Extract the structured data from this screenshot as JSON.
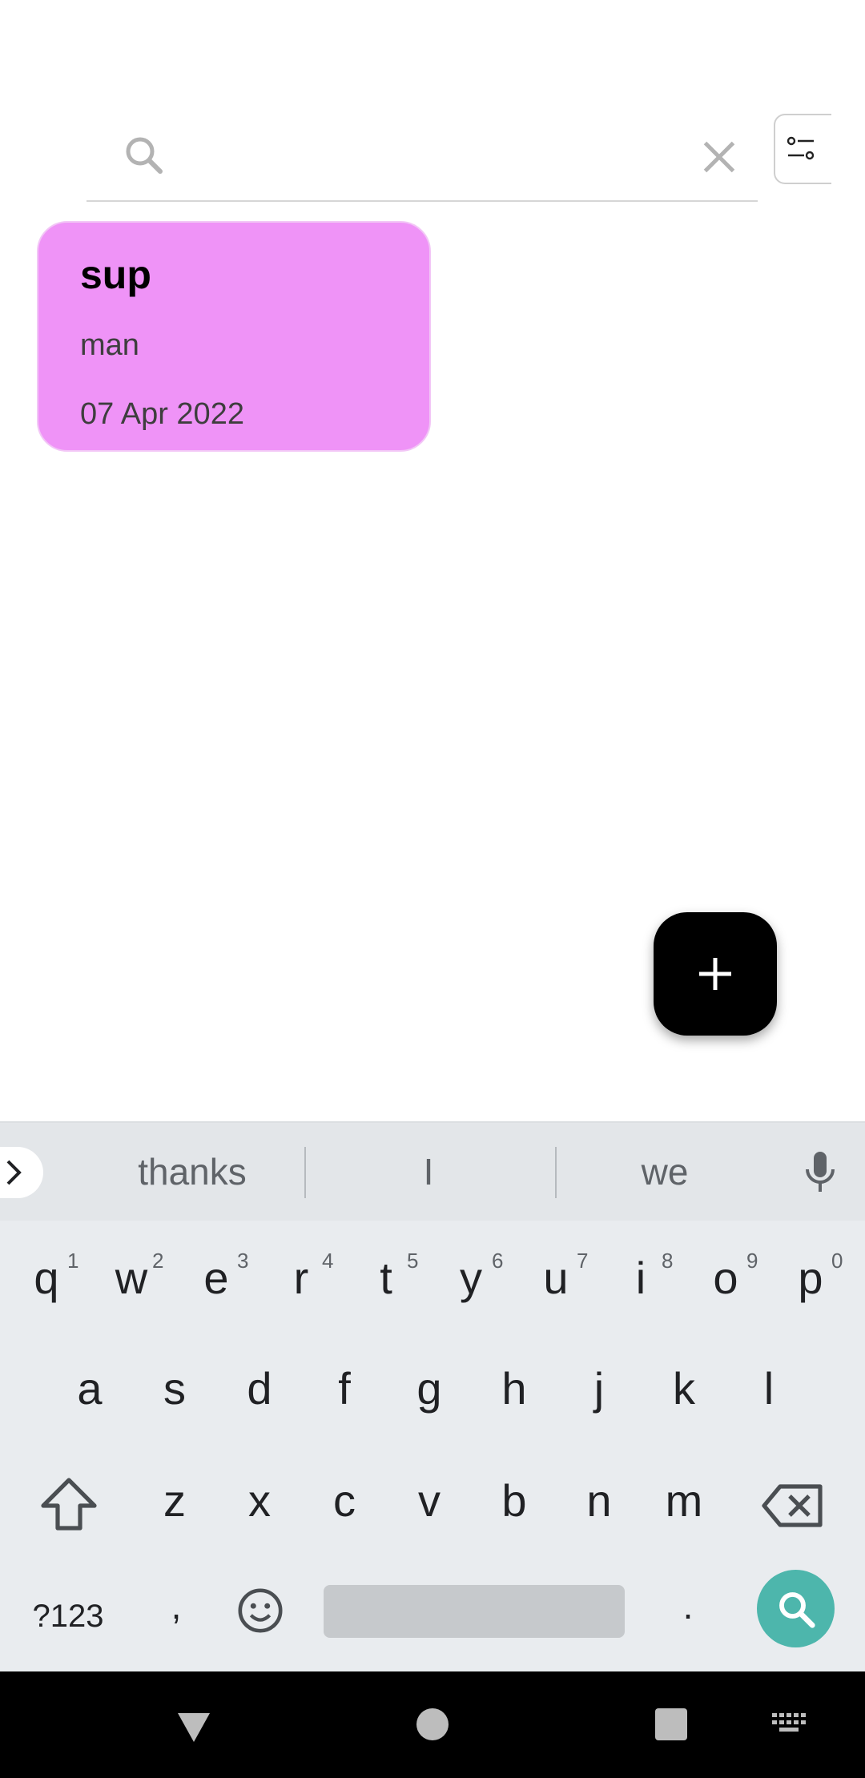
{
  "search": {
    "value": "",
    "placeholder": ""
  },
  "notes": [
    {
      "title": "sup",
      "body": "man",
      "date": "07 Apr 2022",
      "color": "#ef93f7"
    }
  ],
  "fab": {
    "icon": "plus-icon"
  },
  "keyboard": {
    "suggestions": [
      "thanks",
      "I",
      "we"
    ],
    "row1": [
      {
        "key": "q",
        "hint": "1"
      },
      {
        "key": "w",
        "hint": "2"
      },
      {
        "key": "e",
        "hint": "3"
      },
      {
        "key": "r",
        "hint": "4"
      },
      {
        "key": "t",
        "hint": "5"
      },
      {
        "key": "y",
        "hint": "6"
      },
      {
        "key": "u",
        "hint": "7"
      },
      {
        "key": "i",
        "hint": "8"
      },
      {
        "key": "o",
        "hint": "9"
      },
      {
        "key": "p",
        "hint": "0"
      }
    ],
    "row2": [
      "a",
      "s",
      "d",
      "f",
      "g",
      "h",
      "j",
      "k",
      "l"
    ],
    "row3": [
      "z",
      "x",
      "c",
      "v",
      "b",
      "n",
      "m"
    ],
    "symbols_label": "?123",
    "comma": ",",
    "period": ".",
    "action_color": "#4db6ac"
  },
  "colors": {
    "note_card": "#ef93f7",
    "keyboard_bg": "#e9ecef",
    "fab_bg": "#000000"
  }
}
